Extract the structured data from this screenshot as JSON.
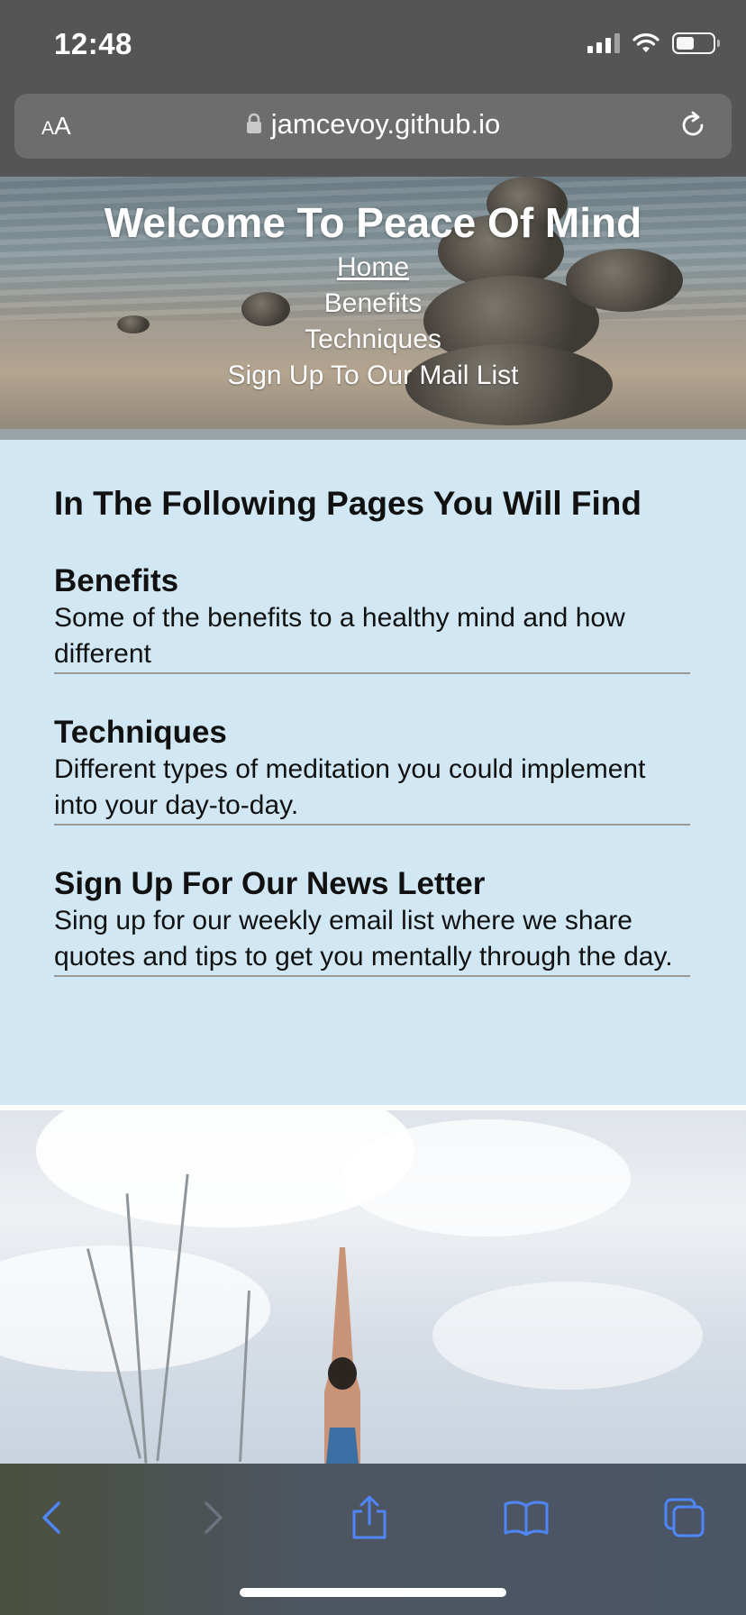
{
  "status_bar": {
    "time": "12:48",
    "icons": [
      "signal-icon",
      "wifi-icon",
      "battery-icon"
    ],
    "battery_level": 0.5
  },
  "url_bar": {
    "text_size_label_small": "A",
    "text_size_label_large": "A",
    "url": "jamcevoy.github.io",
    "icons": [
      "lock-icon",
      "reload-icon"
    ]
  },
  "hero": {
    "title": "Welcome To Peace Of Mind",
    "nav": [
      {
        "label": "Home",
        "active": true
      },
      {
        "label": "Benefits",
        "active": false
      },
      {
        "label": "Techniques",
        "active": false
      },
      {
        "label": "Sign Up To Our Mail List",
        "active": false
      }
    ]
  },
  "info": {
    "heading": "In The Following Pages You Will Find",
    "items": [
      {
        "title": "Benefits",
        "text": "Some of the benefits to a healthy mind and how different"
      },
      {
        "title": "Techniques",
        "text": "Different types of meditation you could implement into your day-to-day."
      },
      {
        "title": "Sign Up For Our News Letter",
        "text": "Sing up for our weekly email list where we share quotes and tips to get you mentally through the day."
      }
    ]
  },
  "toolbar": {
    "buttons": [
      "back-icon",
      "forward-icon",
      "share-icon",
      "bookmarks-icon",
      "tabs-icon"
    ],
    "accent_color": "#4f86f7",
    "disabled_color": "#6b7380"
  },
  "colors": {
    "browser_chrome": "#555555",
    "section_background": "#d1e8f4",
    "hero_text": "#ffffff"
  }
}
